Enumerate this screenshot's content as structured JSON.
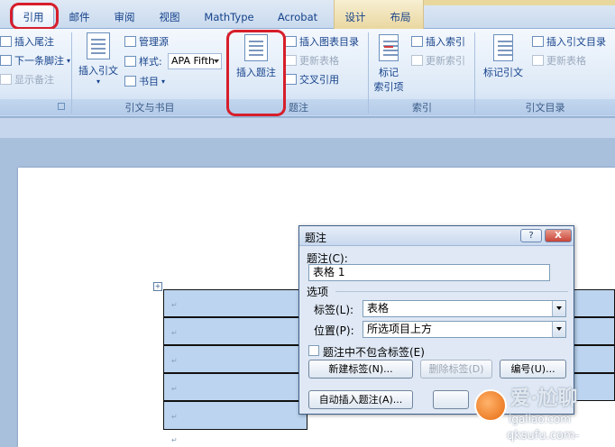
{
  "tabs": [
    {
      "label": "引用",
      "active": true
    },
    {
      "label": "邮件"
    },
    {
      "label": "审阅"
    },
    {
      "label": "视图"
    },
    {
      "label": "MathType"
    },
    {
      "label": "Acrobat"
    },
    {
      "label": "设计"
    },
    {
      "label": "布局"
    }
  ],
  "ribbon": {
    "footnotes": {
      "insert_endnote": "插入尾注",
      "next_footnote": "下一条脚注",
      "show_notes": "显示备注"
    },
    "citations": {
      "insert_citation": "插入引文",
      "manage_sources": "管理源",
      "style_label": "样式:",
      "style_value": "APA Fifth",
      "bibliography": "书目",
      "group_label": "引文与书目"
    },
    "captions": {
      "insert_caption": "插入题注",
      "insert_table_of_figures": "插入图表目录",
      "update_table": "更新表格",
      "cross_reference": "交叉引用",
      "group_label": "题注"
    },
    "index": {
      "mark_entry_line1": "标记",
      "mark_entry_line2": "索引项",
      "insert_index": "插入索引",
      "update_index": "更新索引",
      "group_label": "索引"
    },
    "toa": {
      "mark_citation": "标记引文",
      "insert_toa": "插入引文目录",
      "update_table": "更新表格",
      "group_label": "引文目录"
    }
  },
  "dialog": {
    "title": "题注",
    "help": "?",
    "close": "X",
    "caption_label": "题注(C):",
    "caption_value": "表格 1",
    "options_label": "选项",
    "label_label": "标签(L):",
    "label_value": "表格",
    "position_label": "位置(P):",
    "position_value": "所选项目上方",
    "exclude_label_checkbox": "题注中不包含标签(E)",
    "new_label_button": "新建标签(N)...",
    "delete_label_button": "删除标签(D)",
    "numbering_button": "编号(U)...",
    "autocaption_button": "自动插入题注(A)..."
  },
  "document": {
    "paragraph_mark": "↵",
    "anchor_glyph": "+"
  },
  "watermark": {
    "brand": "爱·尬聊",
    "url1": "igaliao.com",
    "url2": "qksufu.com-"
  },
  "colors": {
    "highlight_red": "#d71e2b",
    "table_fill": "#bcd4ef",
    "ribbon_text": "#15428b"
  }
}
